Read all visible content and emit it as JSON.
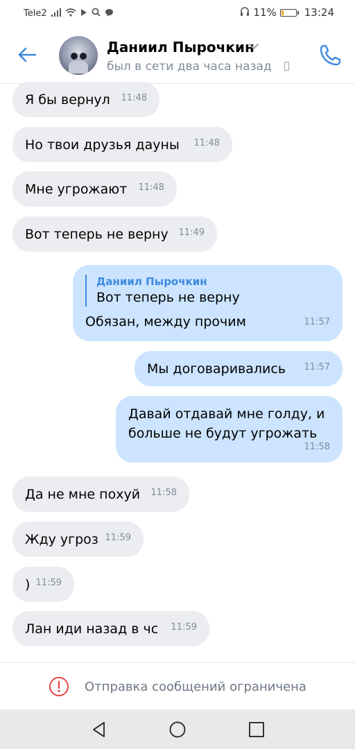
{
  "status_bar": {
    "carrier": "Tele2",
    "battery_percent": "11%",
    "time": "13:24"
  },
  "header": {
    "contact_name": "Даниил Пырочкин",
    "status": "был в сети два часа назад"
  },
  "messages": [
    {
      "direction": "in",
      "text": "Я бы вернул",
      "time": "11:48"
    },
    {
      "direction": "in",
      "text": "Но твои друзья дауны",
      "time": "11:48"
    },
    {
      "direction": "in",
      "text": "Мне угрожают",
      "time": "11:48"
    },
    {
      "direction": "in",
      "text": "Вот теперь не верну",
      "time": "11:49"
    },
    {
      "direction": "out",
      "reply_author": "Даниил Пырочкин",
      "reply_text": "Вот теперь не верну",
      "text": "Обязан, между прочим",
      "time": "11:57"
    },
    {
      "direction": "out",
      "text": "Мы договаривались",
      "time": "11:57"
    },
    {
      "direction": "out",
      "line1": "Давай отдавай мне голду, и",
      "line2": "больше не будут угрожать",
      "time": "11:58"
    },
    {
      "direction": "in",
      "text": "Да не мне похуй",
      "time": "11:58"
    },
    {
      "direction": "in",
      "text": "Жду угроз",
      "time": "11:59"
    },
    {
      "direction": "in",
      "text": ")",
      "time": "11:59"
    },
    {
      "direction": "in",
      "text": "Лан иди назад в чс",
      "time": "11:59"
    }
  ],
  "restriction": {
    "text": "Отправка сообщений ограничена"
  },
  "colors": {
    "accent": "#3f8ae0",
    "incoming_bubble": "#ebedf0",
    "outgoing_bubble": "#cce4ff",
    "warning": "#e64646"
  },
  "icons": {
    "back": "arrow-left-icon",
    "call": "phone-icon",
    "warning": "exclamation-circle-icon",
    "nav_back": "triangle-back-icon",
    "nav_home": "circle-home-icon",
    "nav_recent": "square-recent-icon"
  }
}
